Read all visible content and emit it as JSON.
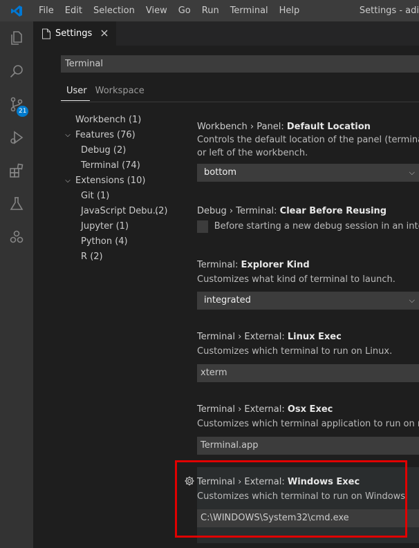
{
  "menu": [
    "File",
    "Edit",
    "Selection",
    "View",
    "Go",
    "Run",
    "Terminal",
    "Help"
  ],
  "window_title": "Settings - adi",
  "activity": {
    "scm_badge": "21"
  },
  "tab": {
    "label": "Settings",
    "close": "×"
  },
  "search": {
    "value": "Terminal"
  },
  "scope_tabs": {
    "user": "User",
    "workspace": "Workspace"
  },
  "toc": [
    {
      "label": "Workbench",
      "count": "(1)",
      "indent": 0,
      "chevron": ""
    },
    {
      "label": "Features",
      "count": "(76)",
      "indent": 0,
      "chevron": "expanded"
    },
    {
      "label": "Debug",
      "count": "(2)",
      "indent": 1,
      "chevron": ""
    },
    {
      "label": "Terminal",
      "count": "(74)",
      "indent": 1,
      "chevron": ""
    },
    {
      "label": "Extensions",
      "count": "(10)",
      "indent": 0,
      "chevron": "expanded"
    },
    {
      "label": "Git",
      "count": "(1)",
      "indent": 1,
      "chevron": ""
    },
    {
      "label": "JavaScript Debu...",
      "count": "(2)",
      "indent": 1,
      "chevron": ""
    },
    {
      "label": "Jupyter",
      "count": "(1)",
      "indent": 1,
      "chevron": ""
    },
    {
      "label": "Python",
      "count": "(4)",
      "indent": 1,
      "chevron": ""
    },
    {
      "label": "R",
      "count": "(2)",
      "indent": 1,
      "chevron": ""
    }
  ],
  "settings": {
    "panel_location": {
      "category": "Workbench › Panel: ",
      "name": "Default Location",
      "desc1": "Controls the default location of the panel (terminal, debug",
      "desc2": "or left of the workbench.",
      "value": "bottom"
    },
    "clear_before_reusing": {
      "category": "Debug › Terminal: ",
      "name": "Clear Before Reusing",
      "desc": "Before starting a new debug session in an integrated"
    },
    "explorer_kind": {
      "category": "Terminal: ",
      "name": "Explorer Kind",
      "desc": "Customizes what kind of terminal to launch.",
      "value": "integrated"
    },
    "linux_exec": {
      "category": "Terminal › External: ",
      "name": "Linux Exec",
      "desc": "Customizes which terminal to run on Linux.",
      "value": "xterm"
    },
    "osx_exec": {
      "category": "Terminal › External: ",
      "name": "Osx Exec",
      "desc": "Customizes which terminal application to run on macOS",
      "value": "Terminal.app"
    },
    "windows_exec": {
      "category": "Terminal › External: ",
      "name": "Windows Exec",
      "desc": "Customizes which terminal to run on Windows.",
      "value": "C:\\WINDOWS\\System32\\cmd.exe"
    }
  },
  "colors": {
    "accent": "#007acc",
    "highlight": "#e00000"
  }
}
